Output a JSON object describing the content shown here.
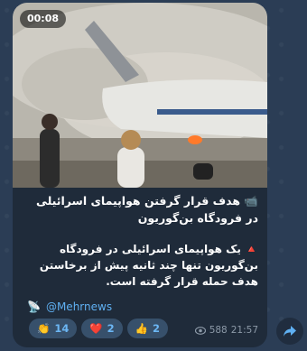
{
  "message": {
    "video": {
      "duration": "00:08"
    },
    "title_prefix_icon": "camera-icon",
    "title": "📹 هدف قرار گرفتن هواپیمای اسرائیلی در فرودگاه بن‌گوریون",
    "body_icon": "red-triangle-icon",
    "body": "🔺 یک هواپیمای اسرائیلی در فرودگاه بن‌گوریون تنها چند ثانیه پیش از برخاستن هدف حمله قرار گرفته است.",
    "source": {
      "icon": "satellite-antenna-icon",
      "label": "@Mehrnews"
    },
    "reactions": [
      {
        "emoji": "👏",
        "icon": "clapping-hands-icon",
        "count": "14"
      },
      {
        "emoji": "❤️",
        "icon": "heart-icon",
        "count": "2"
      },
      {
        "emoji": "👍",
        "icon": "thumbs-up-icon",
        "count": "2"
      }
    ],
    "views": "588",
    "views_icon": "eye-icon",
    "time": "21:57"
  },
  "share_icon": "share-arrow-icon",
  "colors": {
    "background": "#2b3d55",
    "bubble": "#1f2b3a",
    "link": "#5fb0f2",
    "reaction_bg": "#37506b",
    "reaction_text": "#6cb7f5",
    "meta": "#8d9aa8"
  }
}
